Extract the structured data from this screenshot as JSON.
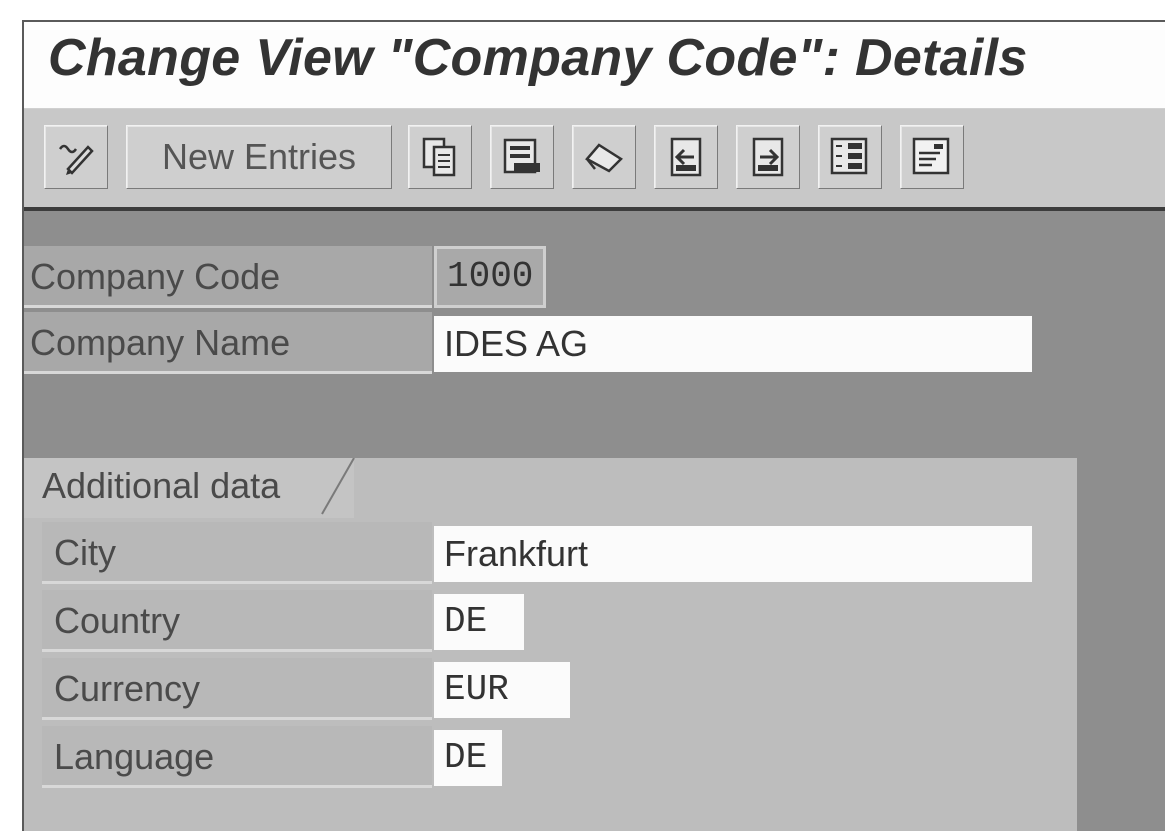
{
  "window": {
    "title": "Change View \"Company Code\": Details"
  },
  "toolbar": {
    "new_entries_label": "New Entries",
    "buttons": [
      {
        "icon": "display-change-icon"
      },
      {
        "icon": "copy-as-icon"
      },
      {
        "icon": "delete-icon"
      },
      {
        "icon": "undo-change-icon"
      },
      {
        "icon": "previous-entry-icon"
      },
      {
        "icon": "next-entry-icon"
      },
      {
        "icon": "select-all-icon"
      },
      {
        "icon": "details-icon"
      }
    ]
  },
  "header_fields": {
    "company_code": {
      "label": "Company Code",
      "value": "1000"
    },
    "company_name": {
      "label": "Company Name",
      "value": "IDES AG"
    }
  },
  "additional_data": {
    "tab_label": "Additional data",
    "city": {
      "label": "City",
      "value": "Frankfurt"
    },
    "country": {
      "label": "Country",
      "value": "DE"
    },
    "currency": {
      "label": "Currency",
      "value": "EUR"
    },
    "language": {
      "label": "Language",
      "value": "DE"
    }
  },
  "colors": {
    "background": "#8e8e8e",
    "panel": "#bdbdbd",
    "input": "#fbfbfb",
    "title_text": "#333333"
  }
}
